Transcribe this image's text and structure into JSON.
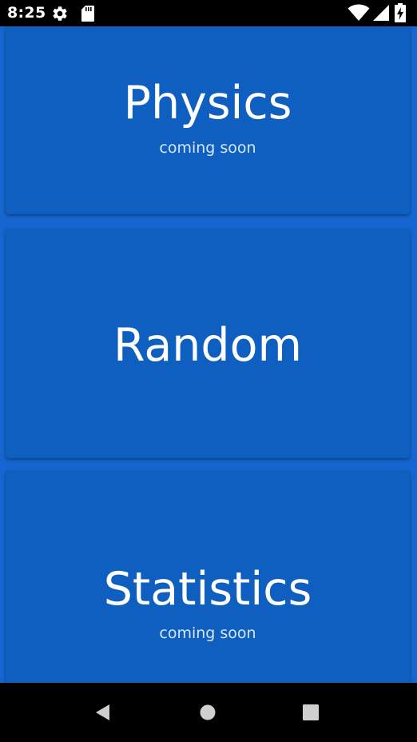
{
  "status_bar": {
    "time": "8:25",
    "icons": [
      "gear-icon",
      "sd-card-icon",
      "wifi-icon",
      "signal-icon",
      "battery-charging-icon"
    ]
  },
  "cards": [
    {
      "title": "Physics",
      "subtitle": "coming soon"
    },
    {
      "title": "Random",
      "subtitle": ""
    },
    {
      "title": "Statistics",
      "subtitle": "coming soon"
    }
  ],
  "colors": {
    "background": "#1566d0",
    "card": "#0e5fc0",
    "text": "#ffffff"
  },
  "nav_bar": {
    "buttons": [
      "back-icon",
      "home-icon",
      "recents-icon"
    ]
  }
}
